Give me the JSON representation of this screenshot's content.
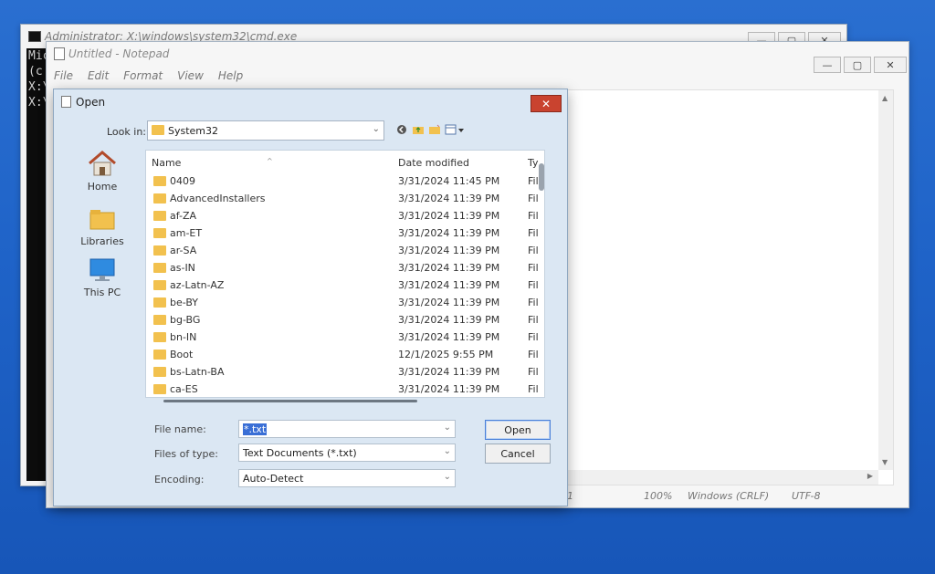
{
  "cmd": {
    "title": "Administrator: X:\\windows\\system32\\cmd.exe",
    "lines": [
      "Mic",
      "(c",
      "",
      "X:\\",
      "",
      "X:\\"
    ]
  },
  "notepad": {
    "title": "Untitled - Notepad",
    "menu": [
      "File",
      "Edit",
      "Format",
      "View",
      "Help"
    ],
    "status": {
      "line": "1",
      "zoom": "100%",
      "eol": "Windows (CRLF)",
      "encoding": "UTF-8"
    }
  },
  "dialog": {
    "title": "Open",
    "close_label": "✕",
    "look_in_label": "Look in:",
    "look_in_value": "System32",
    "places": [
      {
        "label": "Home",
        "icon": "home-icon"
      },
      {
        "label": "Libraries",
        "icon": "libraries-icon"
      },
      {
        "label": "This PC",
        "icon": "this-pc-icon"
      }
    ],
    "columns": {
      "name": "Name",
      "date": "Date modified",
      "type": "Ty"
    },
    "files": [
      {
        "name": "0409",
        "date": "3/31/2024 11:45 PM",
        "type": "Fil"
      },
      {
        "name": "AdvancedInstallers",
        "date": "3/31/2024 11:39 PM",
        "type": "Fil"
      },
      {
        "name": "af-ZA",
        "date": "3/31/2024 11:39 PM",
        "type": "Fil"
      },
      {
        "name": "am-ET",
        "date": "3/31/2024 11:39 PM",
        "type": "Fil"
      },
      {
        "name": "ar-SA",
        "date": "3/31/2024 11:39 PM",
        "type": "Fil"
      },
      {
        "name": "as-IN",
        "date": "3/31/2024 11:39 PM",
        "type": "Fil"
      },
      {
        "name": "az-Latn-AZ",
        "date": "3/31/2024 11:39 PM",
        "type": "Fil"
      },
      {
        "name": "be-BY",
        "date": "3/31/2024 11:39 PM",
        "type": "Fil"
      },
      {
        "name": "bg-BG",
        "date": "3/31/2024 11:39 PM",
        "type": "Fil"
      },
      {
        "name": "bn-IN",
        "date": "3/31/2024 11:39 PM",
        "type": "Fil"
      },
      {
        "name": "Boot",
        "date": "12/1/2025 9:55 PM",
        "type": "Fil"
      },
      {
        "name": "bs-Latn-BA",
        "date": "3/31/2024 11:39 PM",
        "type": "Fil"
      },
      {
        "name": "ca-ES",
        "date": "3/31/2024 11:39 PM",
        "type": "Fil"
      }
    ],
    "file_name_label": "File name:",
    "file_name_value": "*.txt",
    "files_of_type_label": "Files of type:",
    "files_of_type_value": "Text Documents (*.txt)",
    "encoding_label": "Encoding:",
    "encoding_value": "Auto-Detect",
    "open_button": "Open",
    "cancel_button": "Cancel"
  },
  "colors": {
    "desktop": "#1f63c8",
    "folder": "#f2c14e",
    "dialog_bg": "#dbe7f3",
    "close_red": "#c9432f",
    "selection": "#3a6fd6"
  }
}
